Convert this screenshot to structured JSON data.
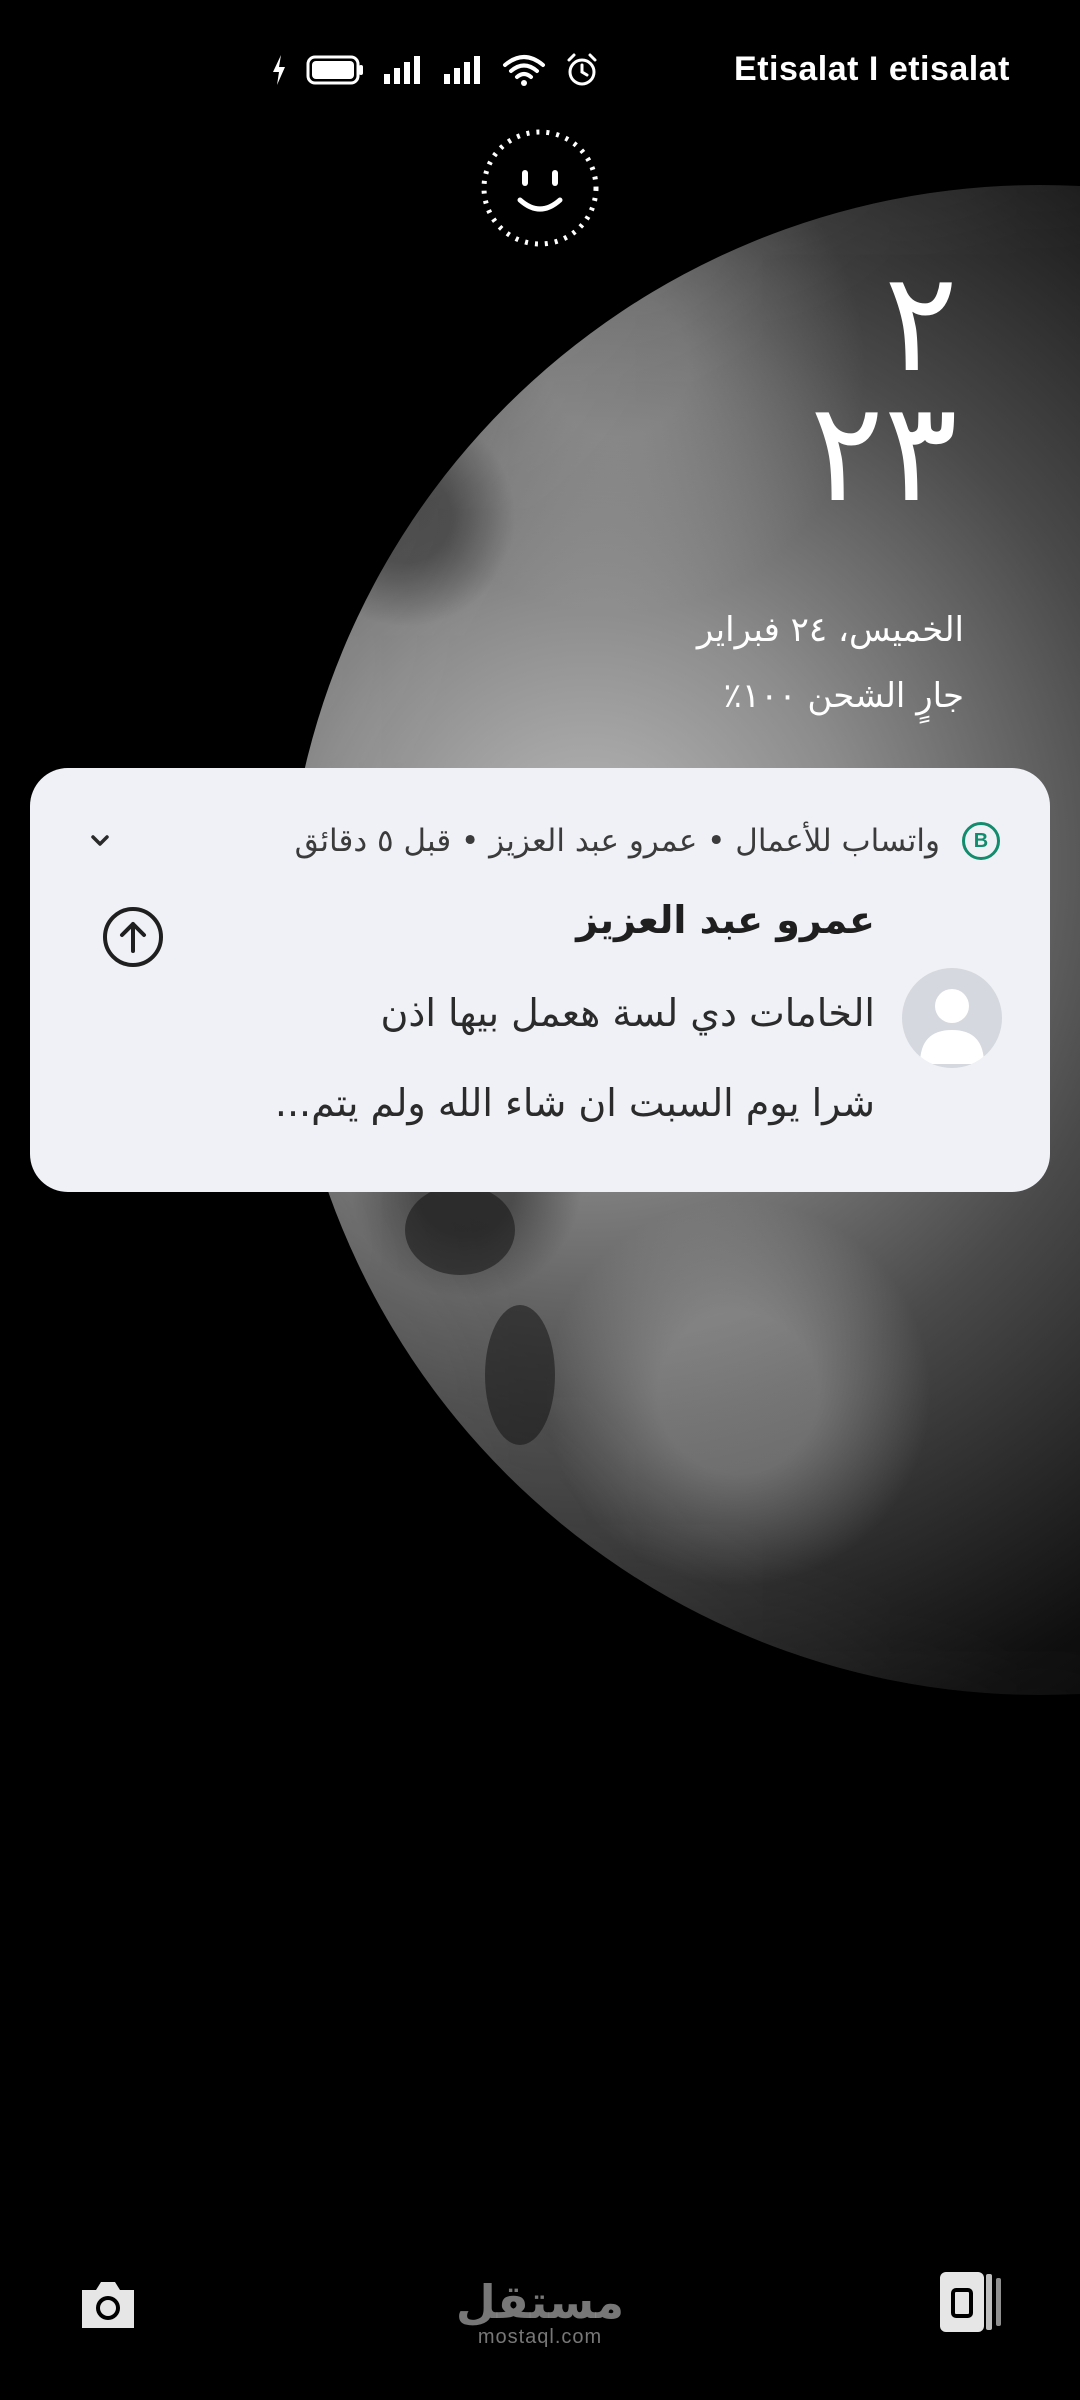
{
  "status_bar": {
    "carrier": "Etisalat I etisalat",
    "icons": [
      "alarm-icon",
      "wifi-icon",
      "signal-icon",
      "signal-icon",
      "battery-icon",
      "charging-icon"
    ]
  },
  "lock": {
    "face_unlock_icon": "face-unlock-icon",
    "clock_hour": "٢",
    "clock_minute": "٢٣",
    "date": "الخميس، ٢٤ فبراير",
    "charging": "جارٍ الشحن ١٠٠٪"
  },
  "notification": {
    "app_badge": "B",
    "meta": "واتساب للأعمال • عمرو عبد العزيز • قبل ٥ دقائق",
    "sender": "عمرو عبد العزيز",
    "message_line1": "الخامات دي لسة هعمل بيها اذن",
    "message_line2": "شرا يوم السبت ان شاء الله ولم يتم...",
    "accent_color": "#128c6c"
  },
  "bottom": {
    "watermark_ar": "مستقل",
    "watermark_en": "mostaql.com",
    "left_shortcut": "camera-icon",
    "right_shortcut": "wallet-icon"
  }
}
